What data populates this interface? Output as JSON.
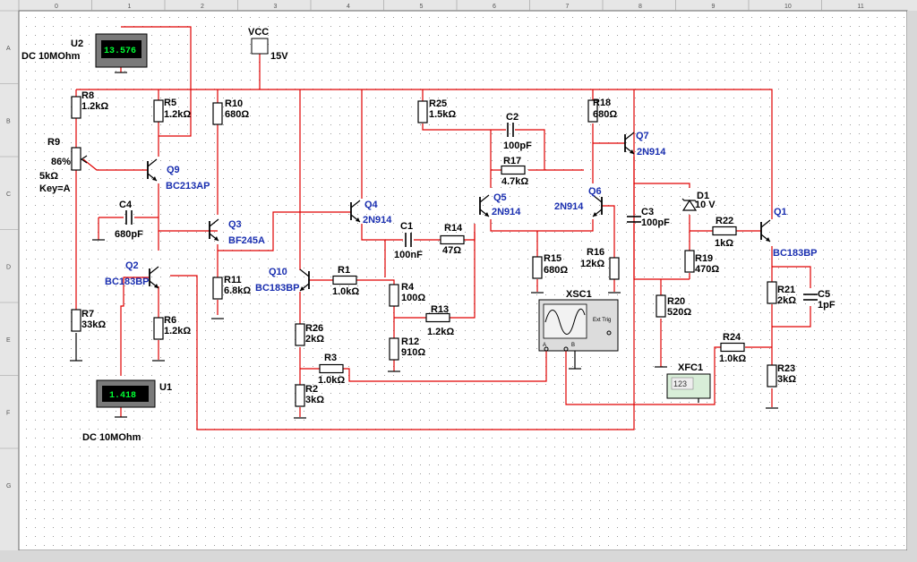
{
  "rulers": {
    "columns": [
      "0",
      "1",
      "2",
      "3",
      "4",
      "5",
      "6",
      "7",
      "8",
      "9",
      "10",
      "11"
    ],
    "rows": [
      "A",
      "B",
      "C",
      "D",
      "E",
      "F",
      "G"
    ]
  },
  "instruments": {
    "u2": {
      "ref": "U2",
      "value": "13.576",
      "mode": "DC  10MOhm"
    },
    "u1": {
      "ref": "U1",
      "value": "1.418",
      "mode": "DC  10MOhm"
    },
    "xsc1": {
      "ref": "XSC1",
      "ext_trig": "Ext Trig",
      "a": "A",
      "b": "B"
    },
    "xfc1": {
      "ref": "XFC1",
      "display": "123"
    }
  },
  "supply": {
    "name": "VCC",
    "value": "15V"
  },
  "resistors": [
    {
      "ref": "R8",
      "value": "1.2kΩ"
    },
    {
      "ref": "R5",
      "value": "1.2kΩ"
    },
    {
      "ref": "R10",
      "value": "680Ω"
    },
    {
      "ref": "R25",
      "value": "1.5kΩ"
    },
    {
      "ref": "R18",
      "value": "680Ω"
    },
    {
      "ref": "R17",
      "value": "4.7kΩ"
    },
    {
      "ref": "R11",
      "value": "6.8kΩ"
    },
    {
      "ref": "R7",
      "value": "33kΩ"
    },
    {
      "ref": "R6",
      "value": "1.2kΩ"
    },
    {
      "ref": "R1",
      "value": "1.0kΩ"
    },
    {
      "ref": "R4",
      "value": "100Ω"
    },
    {
      "ref": "R14",
      "value": "47Ω"
    },
    {
      "ref": "R13",
      "value": "1.2kΩ"
    },
    {
      "ref": "R12",
      "value": "910Ω"
    },
    {
      "ref": "R26",
      "value": "2kΩ"
    },
    {
      "ref": "R3",
      "value": "1.0kΩ"
    },
    {
      "ref": "R2",
      "value": "3kΩ"
    },
    {
      "ref": "R15",
      "value": "680Ω"
    },
    {
      "ref": "R16",
      "value": "12kΩ"
    },
    {
      "ref": "R22",
      "value": "1kΩ"
    },
    {
      "ref": "R19",
      "value": "470Ω"
    },
    {
      "ref": "R20",
      "value": "520Ω"
    },
    {
      "ref": "R24",
      "value": "1.0kΩ"
    },
    {
      "ref": "R21",
      "value": "2kΩ"
    },
    {
      "ref": "R23",
      "value": "3kΩ"
    }
  ],
  "potentiometer": {
    "ref": "R9",
    "percent": "86%",
    "value": "5kΩ",
    "key": "Key=A"
  },
  "capacitors": [
    {
      "ref": "C4",
      "value": "680pF"
    },
    {
      "ref": "C1",
      "value": "100nF"
    },
    {
      "ref": "C2",
      "value": "100pF"
    },
    {
      "ref": "C3",
      "value": "100pF"
    },
    {
      "ref": "C5",
      "value": "1pF"
    }
  ],
  "diode": {
    "ref": "D1",
    "value": "10 V"
  },
  "transistors": [
    {
      "ref": "Q9",
      "model": "BC213AP"
    },
    {
      "ref": "Q3",
      "model": "BF245A"
    },
    {
      "ref": "Q2",
      "model": "BC183BP"
    },
    {
      "ref": "Q4",
      "model": "2N914"
    },
    {
      "ref": "Q10",
      "model": "BC183BP"
    },
    {
      "ref": "Q5",
      "model": "2N914"
    },
    {
      "ref": "Q6",
      "model": "2N914"
    },
    {
      "ref": "Q7",
      "model": "2N914"
    },
    {
      "ref": "Q1",
      "model": "BC183BP"
    }
  ],
  "colors": {
    "wire": "#e00000",
    "component": "#000000",
    "label": "#000000",
    "transistor_label": "#1a2fb0",
    "meter_display": "#00ff33",
    "meter_body": "#7a7a7a",
    "frame": "#e8e8e8"
  }
}
